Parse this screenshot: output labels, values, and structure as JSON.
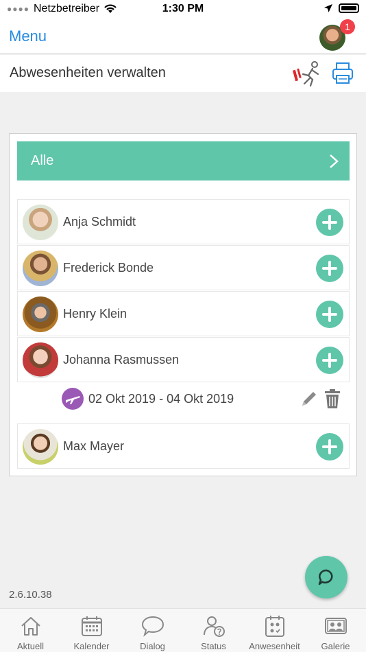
{
  "status_bar": {
    "carrier": "Netzbetreiber",
    "time": "1:30 PM"
  },
  "nav": {
    "menu_label": "Menu",
    "badge_count": "1"
  },
  "subheader": {
    "title": "Abwesenheiten verwalten"
  },
  "filter": {
    "label": "Alle"
  },
  "children": [
    {
      "name": "Anja Schmidt"
    },
    {
      "name": "Frederick Bonde"
    },
    {
      "name": "Henry Klein"
    },
    {
      "name": "Johanna Rasmussen"
    },
    {
      "name": "Max Mayer"
    }
  ],
  "absence": {
    "dates": "02 Okt 2019 - 04 Okt 2019",
    "color": "#9b59b6"
  },
  "version": "2.6.10.38",
  "tabs": [
    {
      "label": "Aktuell",
      "icon": "home-icon"
    },
    {
      "label": "Kalender",
      "icon": "calendar-icon"
    },
    {
      "label": "Dialog",
      "icon": "speech-bubble-icon"
    },
    {
      "label": "Status",
      "icon": "user-question-icon"
    },
    {
      "label": "Anwesenheit",
      "icon": "attendance-icon"
    },
    {
      "label": "Galerie",
      "icon": "gallery-icon"
    }
  ],
  "colors": {
    "accent": "#5fc6aa",
    "link": "#2a8be0",
    "badge": "#f0404a"
  }
}
